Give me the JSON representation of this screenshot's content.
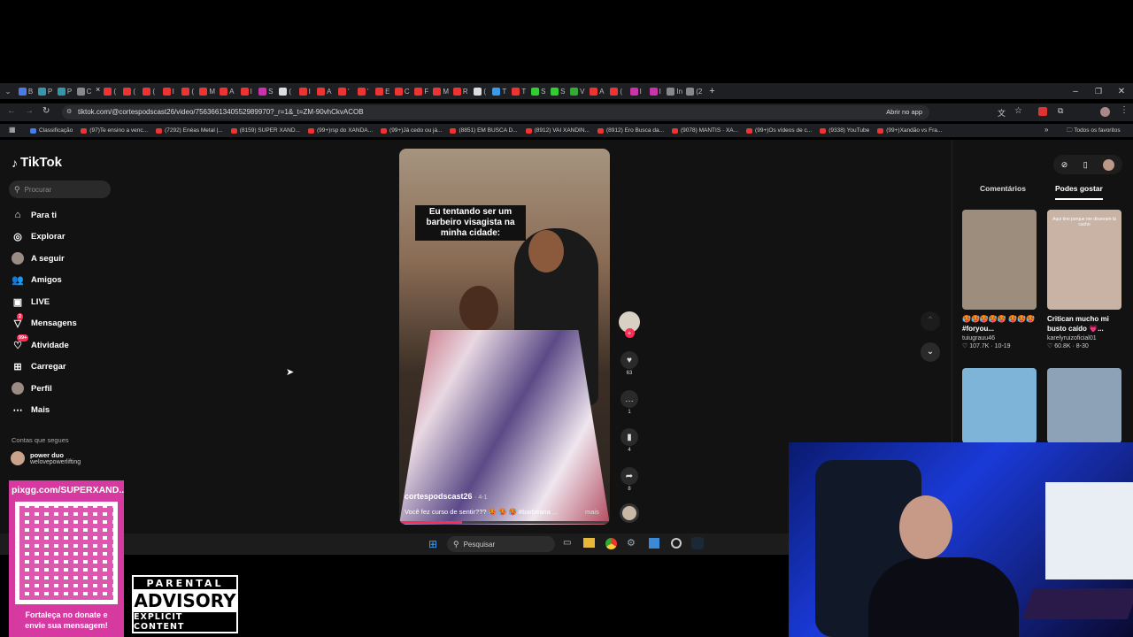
{
  "browser": {
    "url": "tiktok.com/@cortespodscast26/video/7563661340552989970?_r=1&_t=ZM-90vhCkvACOB",
    "open_app_label": "Abrir no app",
    "tab_letters": [
      "B",
      "P",
      "P",
      "C",
      "(",
      "(",
      "(",
      "I",
      "(",
      "M",
      "A",
      "I",
      "S",
      "(",
      "I",
      "A",
      "'",
      "'",
      "E",
      "C",
      "F",
      "M",
      "R",
      "(",
      "T",
      "T",
      "S",
      "S",
      "V",
      "A",
      "(",
      "I",
      "I",
      "In",
      "(2"
    ],
    "active_tab_close": "×",
    "bookmarks": [
      "Classificação",
      "(97)Te ensino a venc...",
      "(7292) Enéas Metal |...",
      "(8159) SUPER XAND...",
      "(99+)rsp do XANDÃ...",
      "(99+)Já cedo ou já...",
      "(8851) EM BUSCA D...",
      "(8912) VAI XANDIN...",
      "(8912) Ero Busca da...",
      "(9078) MANTIS · XA...",
      "(99+)Os vídeos de c...",
      "(9338) YouTube",
      "(99+)Xandão vs Fra..."
    ],
    "bookmarks_more": "»",
    "all_favorites": "Todos os favoritos"
  },
  "tiktok": {
    "logo": "TikTok",
    "search_placeholder": "Procurar",
    "nav": [
      {
        "label": "Para ti",
        "icon": "home-icon"
      },
      {
        "label": "Explorar",
        "icon": "compass-icon"
      },
      {
        "label": "A seguir",
        "icon": "following-avatar-icon"
      },
      {
        "label": "Amigos",
        "icon": "friends-icon"
      },
      {
        "label": "LIVE",
        "icon": "live-icon"
      },
      {
        "label": "Mensagens",
        "icon": "messages-icon",
        "badge": "2"
      },
      {
        "label": "Atividade",
        "icon": "activity-icon",
        "badge": "99+"
      },
      {
        "label": "Carregar",
        "icon": "upload-icon"
      },
      {
        "label": "Perfil",
        "icon": "profile-avatar-icon"
      },
      {
        "label": "Mais",
        "icon": "more-icon"
      }
    ],
    "following_heading": "Contas que segues",
    "following": [
      {
        "name": "power duo",
        "handle": "welovepowerlifting"
      }
    ],
    "video": {
      "caption_overlay": "Eu tentando ser um barbeiro visagista na minha cidade:",
      "author": "cortespodscast26",
      "author_suffix": "· 4-1",
      "description": "Você fez curso de sentir??? 🥵 🥵 🥵 #barbearia ...",
      "more_label": "mais",
      "likes": "63",
      "comments": "1",
      "saves": "4",
      "shares": "8"
    },
    "right_tabs": [
      "Comentários",
      "Podes gostar"
    ],
    "right_active_tab": "Podes gostar",
    "suggestions": [
      {
        "title": "🥵🥵🥵🥵🥵 🥵🥵🥵#foryou...",
        "user": "tuiugrauu46",
        "likes": "107.7K",
        "date": "10-19",
        "color": "#9c8d7d"
      },
      {
        "title": "Critican mucho mi busto caído 💗...",
        "user": "karelyruizoficial01",
        "likes": "60.8K",
        "date": "8-30",
        "color": "#c9b3a5",
        "thumb_text": "Aqui tirei porque me disseram lá cacho"
      },
      {
        "title": "",
        "user": "",
        "likes": "",
        "date": "",
        "color": "#7eb4d8"
      },
      {
        "title": "",
        "user": "",
        "likes": "",
        "date": "",
        "color": "#8ea2b7"
      }
    ]
  },
  "taskbar": {
    "search_placeholder": "Pesquisar"
  },
  "overlay": {
    "pix_url": "pixgg.com/SUPERXAND...",
    "donate_text": "Fortaleça no donate e envie sua mensagem!",
    "advisory_top": "PARENTAL",
    "advisory_mid": "ADVISORY",
    "advisory_bottom": "EXPLICIT CONTENT"
  }
}
